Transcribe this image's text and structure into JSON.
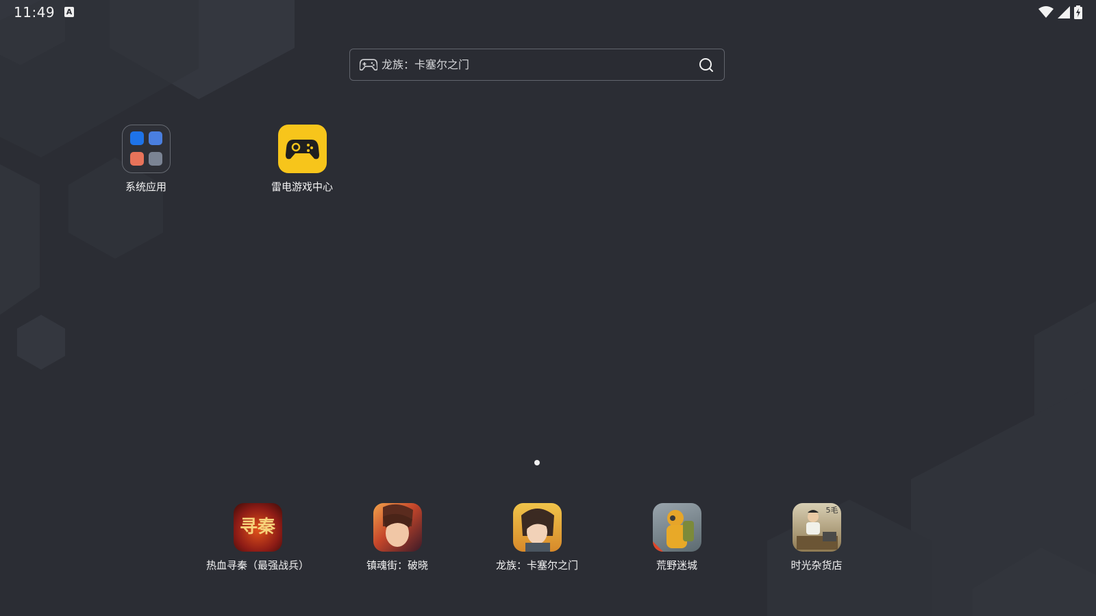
{
  "status_bar": {
    "time": "11:49",
    "ime_badge": "A",
    "icons": [
      "wifi-icon",
      "cellular-signal-icon",
      "battery-charging-icon"
    ]
  },
  "search": {
    "placeholder": "龙族：卡塞尔之门",
    "left_icon": "gamepad-icon",
    "right_icon": "search-icon"
  },
  "desktop_apps": [
    {
      "label": "系统应用",
      "icon": "system-apps-folder-icon"
    },
    {
      "label": "雷电游戏中心",
      "icon": "gamepad-icon",
      "color": "#f7c51b"
    }
  ],
  "page_indicator": {
    "pages": 1,
    "current": 1
  },
  "dock_apps": [
    {
      "label": "热血寻秦（最强战兵）",
      "icon_text": "寻秦",
      "color": "#8e1c16"
    },
    {
      "label": "镇魂街：破晓",
      "color": "#c5462a"
    },
    {
      "label": "龙族：卡塞尔之门",
      "color": "#e8b43a"
    },
    {
      "label": "荒野迷城",
      "color": "#e8a928"
    },
    {
      "label": "时光杂货店",
      "icon_text": "5毛",
      "color": "#b8a77e"
    }
  ]
}
